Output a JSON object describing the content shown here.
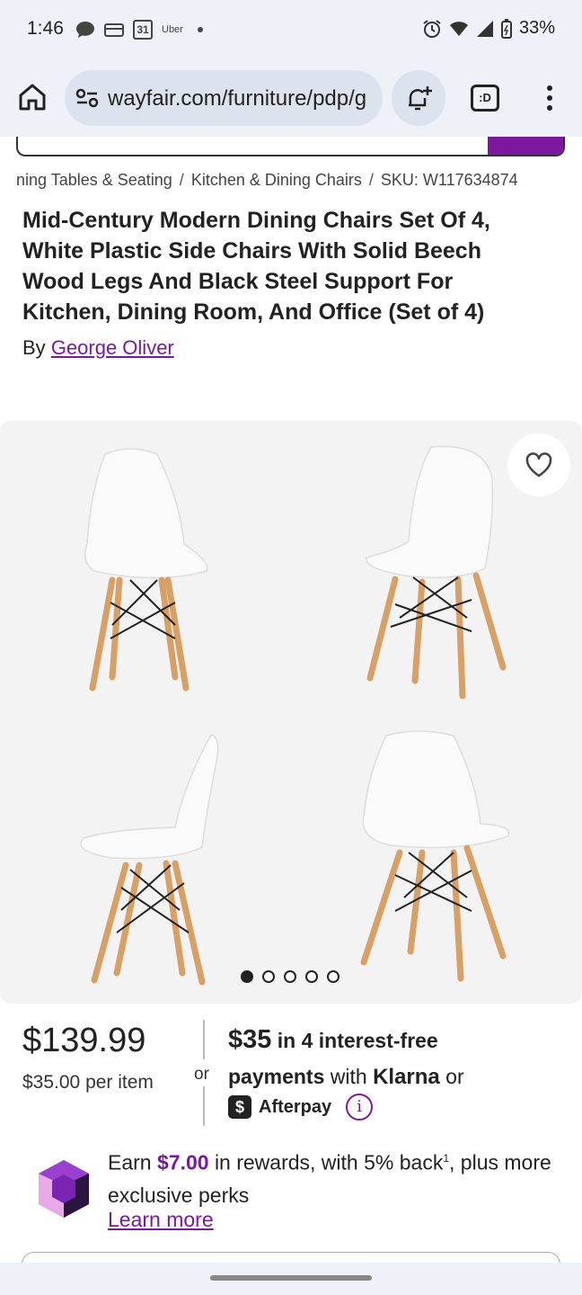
{
  "status_bar": {
    "time": "1:46",
    "calendar_day": "31",
    "uber": "Uber",
    "battery": "33%",
    "icons": [
      "chat-icon",
      "wallet-icon",
      "calendar-icon",
      "uber-icon",
      "dot-icon",
      "alarm-icon",
      "wifi-icon",
      "signal-icon",
      "battery-icon"
    ]
  },
  "browser": {
    "url": "wayfair.com/furniture/pdp/g",
    "tab_icon_label": ":D"
  },
  "breadcrumb": {
    "items": [
      "ning Tables & Seating",
      "Kitchen & Dining Chairs",
      "SKU: W117634874"
    ],
    "separator": "/"
  },
  "product": {
    "title": "Mid-Century Modern Dining Chairs Set Of 4, White Plastic Side Chairs With Solid Beech Wood Legs And Black Steel Support For Kitchen, Dining Room, And Office (Set of 4)",
    "by_label": "By",
    "brand": "George Oliver"
  },
  "gallery": {
    "image_count": 5,
    "active_index": 0
  },
  "pricing": {
    "price": "$139.99",
    "per_item": "$35.00 per item",
    "or": "or",
    "installment_amount": "$35",
    "installment_text": "in 4 interest-free",
    "payments_word": "payments",
    "with_word": "with",
    "klarna": "Klarna",
    "or2": "or",
    "afterpay_badge": "$",
    "afterpay": "Afterpay",
    "info": "i"
  },
  "rewards": {
    "earn": "Earn",
    "amount": "$7.00",
    "text_after": "in rewards, with 5% back",
    "footnote": "1",
    "text_end": ", plus more exclusive perks",
    "learn_more": "Learn more"
  },
  "colors": {
    "brand_purple": "#7b189f",
    "status_bg": "#eef1f8",
    "gallery_bg": "#f3f3f3"
  }
}
